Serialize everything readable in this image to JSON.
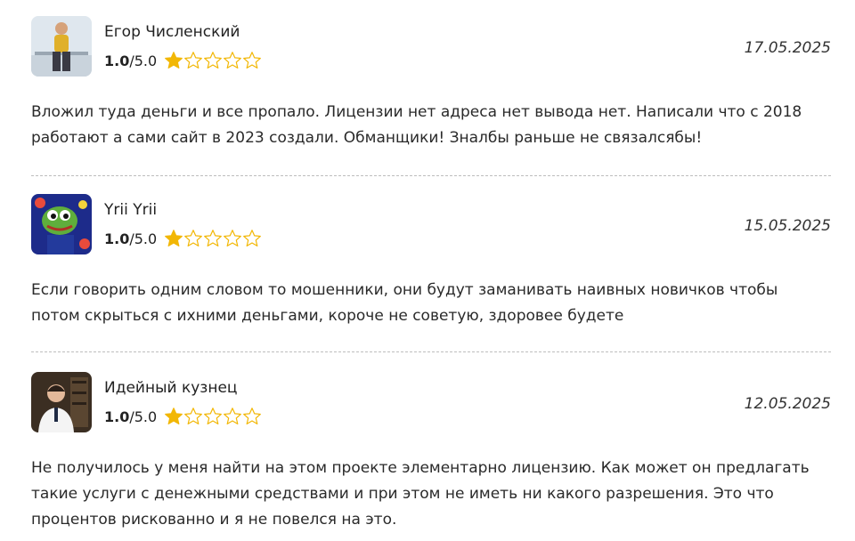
{
  "reviews": [
    {
      "author": "Егор Численский",
      "score": "1.0",
      "score_max": "/5.0",
      "stars_filled": 1,
      "stars_total": 5,
      "date": "17.05.2025",
      "text": "Вложил туда деньги и все пропало. Лицензии нет адреса нет вывода нет. Написали что с 2018 работают а сами сайт в 2023 создали. Обманщики! Зналбы раньше не связалсябы!"
    },
    {
      "author": "Yrii Yrii",
      "score": "1.0",
      "score_max": "/5.0",
      "stars_filled": 1,
      "stars_total": 5,
      "date": "15.05.2025",
      "text": "Если говорить одним словом то мошенники, они будут заманивать наивных новичков чтобы потом скрыться с ихними деньгами, короче не советую, здоровее будете"
    },
    {
      "author": "Идейный кузнец",
      "score": "1.0",
      "score_max": "/5.0",
      "stars_filled": 1,
      "stars_total": 5,
      "date": "12.05.2025",
      "text": "Не получилось у меня найти на этом проекте элементарно лицензию. Как может он предлагать такие услуги с денежными средствами и при этом не иметь ни какого разрешения. Это что процентов рискованно и я не повелся на это."
    }
  ],
  "colors": {
    "star": "#f2b705",
    "divider": "#bdbdbd"
  }
}
